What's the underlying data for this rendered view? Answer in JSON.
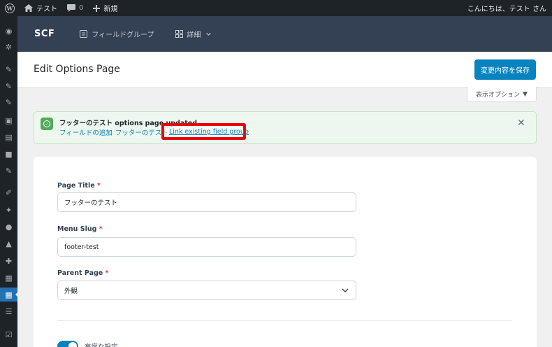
{
  "adminbar": {
    "site_name": "テスト",
    "comments_count": "0",
    "new_label": "新規",
    "greeting": "こんにちは、テスト さん"
  },
  "scf_nav": {
    "logo": "SCF",
    "field_groups_label": "フィールドグループ",
    "more_label": "詳細"
  },
  "header": {
    "title": "Edit Options Page",
    "save_label": "変更内容を保存",
    "screen_options_label": "表示オプション"
  },
  "notice": {
    "title": "フッターのテスト options page updated",
    "link_add_fields": "フィールドの追加",
    "link_page": "フッターのテスト",
    "link_existing": "Link existing field group"
  },
  "form": {
    "page_title_label": "Page Title",
    "page_title_value": "フッターのテスト",
    "menu_slug_label": "Menu Slug",
    "menu_slug_value": "footer-test",
    "parent_page_label": "Parent Page",
    "parent_page_value": "外観",
    "required_mark": "*",
    "advanced_label": "高度な設定"
  },
  "colors": {
    "admin_bar": "#1d2327",
    "scf_nav": "#344054",
    "accent": "#0783be",
    "success": "#52aa59",
    "highlight": "#ea0000"
  }
}
